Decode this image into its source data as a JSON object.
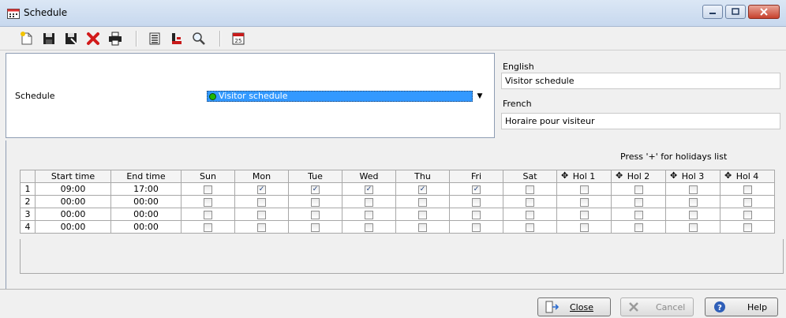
{
  "window": {
    "title": "Schedule"
  },
  "toolbar": {
    "items": [
      "new-icon",
      "save-icon",
      "save-as-icon",
      "delete-icon",
      "print-icon",
      "list-icon",
      "link-icon",
      "search-icon",
      "calendar-icon"
    ]
  },
  "schedule": {
    "label": "Schedule",
    "selected": "Visitor schedule"
  },
  "languages": {
    "english_label": "English",
    "english_value": "Visitor schedule",
    "french_label": "French",
    "french_value": "Horaire pour visiteur"
  },
  "grid": {
    "hint": "Press '+' for holidays list",
    "columns": [
      "",
      "Start time",
      "End time",
      "Sun",
      "Mon",
      "Tue",
      "Wed",
      "Thu",
      "Fri",
      "Sat",
      "Hol 1",
      "Hol 2",
      "Hol 3",
      "Hol 4"
    ],
    "rows": [
      {
        "num": "1",
        "start": "09:00",
        "end": "17:00",
        "checks": [
          false,
          true,
          true,
          true,
          true,
          true,
          false,
          false,
          false,
          false,
          false
        ]
      },
      {
        "num": "2",
        "start": "00:00",
        "end": "00:00",
        "checks": [
          false,
          false,
          false,
          false,
          false,
          false,
          false,
          false,
          false,
          false,
          false
        ]
      },
      {
        "num": "3",
        "start": "00:00",
        "end": "00:00",
        "checks": [
          false,
          false,
          false,
          false,
          false,
          false,
          false,
          false,
          false,
          false,
          false
        ]
      },
      {
        "num": "4",
        "start": "00:00",
        "end": "00:00",
        "checks": [
          false,
          false,
          false,
          false,
          false,
          false,
          false,
          false,
          false,
          false,
          false
        ]
      }
    ]
  },
  "buttons": {
    "close": "Close",
    "cancel": "Cancel",
    "help": "Help"
  }
}
